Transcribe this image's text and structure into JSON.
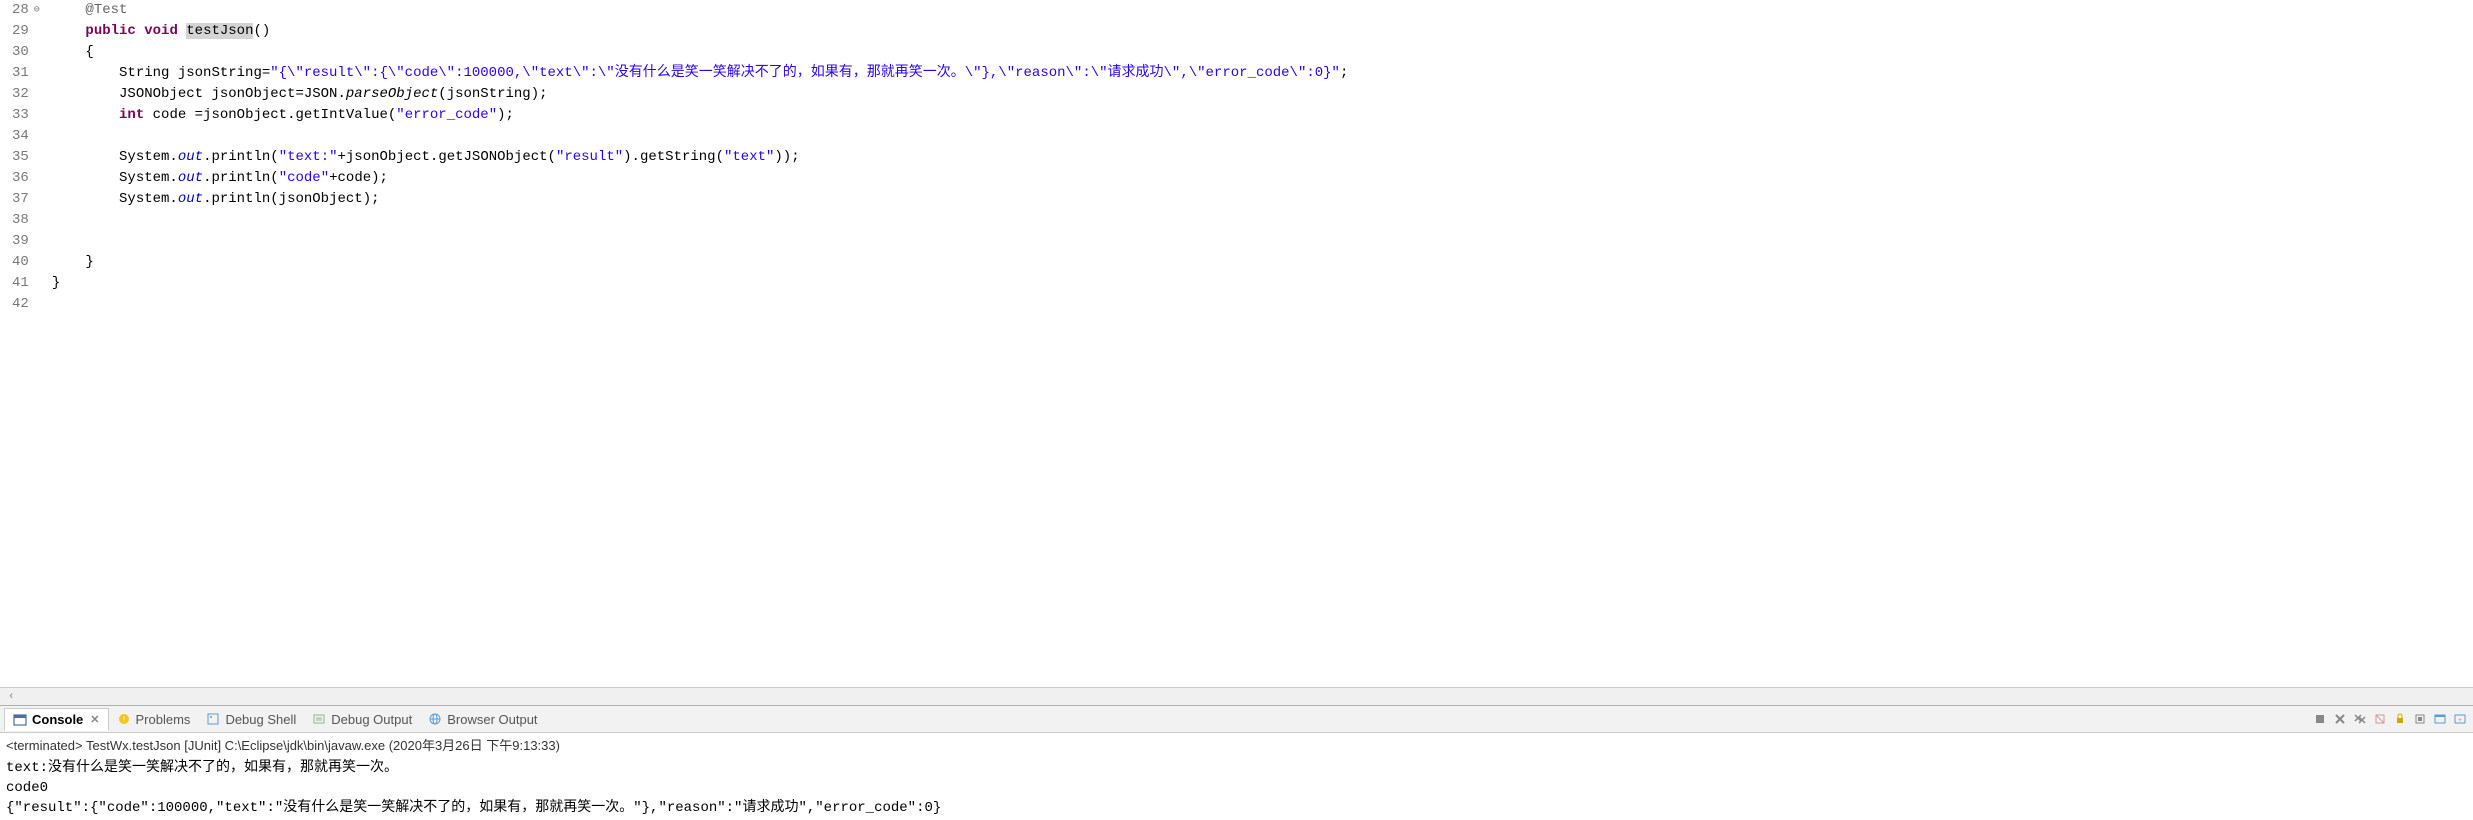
{
  "editor": {
    "lines": [
      {
        "num": 28,
        "fold": "minus",
        "html": "    <span class='ann'>@Test</span>"
      },
      {
        "num": 29,
        "html": "    <span class='kw'>public</span> <span class='kw'>void</span> <span class='highlight-method'>testJson</span>()"
      },
      {
        "num": 30,
        "html": "    {"
      },
      {
        "num": 31,
        "html": "        String jsonString=<span class='str'>\"{\\\"result\\\":{\\\"code\\\":100000,\\\"text\\\":\\\"没有什么是笑一笑解决不了的，如果有，那就再笑一次。\\\"},\\\"reason\\\":\\\"请求成功\\\",\\\"error_code\\\":0}\"</span>;"
      },
      {
        "num": 32,
        "html": "        JSONObject jsonObject=JSON.<span class='method-italic'>parseObject</span>(jsonString);"
      },
      {
        "num": 33,
        "html": "        <span class='kw'>int</span> code =jsonObject.getIntValue(<span class='str'>\"error_code\"</span>);"
      },
      {
        "num": 34,
        "html": ""
      },
      {
        "num": 35,
        "html": "        System.<span class='field-italic'>out</span>.println(<span class='str'>\"text:\"</span>+jsonObject.getJSONObject(<span class='str'>\"result\"</span>).getString(<span class='str'>\"text\"</span>));"
      },
      {
        "num": 36,
        "html": "        System.<span class='field-italic'>out</span>.println(<span class='str'>\"code\"</span>+code);"
      },
      {
        "num": 37,
        "html": "        System.<span class='field-italic'>out</span>.println(jsonObject);"
      },
      {
        "num": 38,
        "html": ""
      },
      {
        "num": 39,
        "html": ""
      },
      {
        "num": 40,
        "html": "    }"
      },
      {
        "num": 41,
        "html": "}"
      },
      {
        "num": 42,
        "html": ""
      }
    ]
  },
  "tabs": {
    "console": "Console",
    "problems": "Problems",
    "debugShell": "Debug Shell",
    "debugOutput": "Debug Output",
    "browserOutput": "Browser Output"
  },
  "console": {
    "header": "<terminated> TestWx.testJson [JUnit] C:\\Eclipse\\jdk\\bin\\javaw.exe (2020年3月26日 下午9:13:33)",
    "lines": [
      "text:没有什么是笑一笑解决不了的，如果有，那就再笑一次。",
      "code0",
      "{\"result\":{\"code\":100000,\"text\":\"没有什么是笑一笑解决不了的，如果有，那就再笑一次。\"},\"reason\":\"请求成功\",\"error_code\":0}"
    ]
  },
  "scroll": {
    "leftArrow": "‹"
  }
}
